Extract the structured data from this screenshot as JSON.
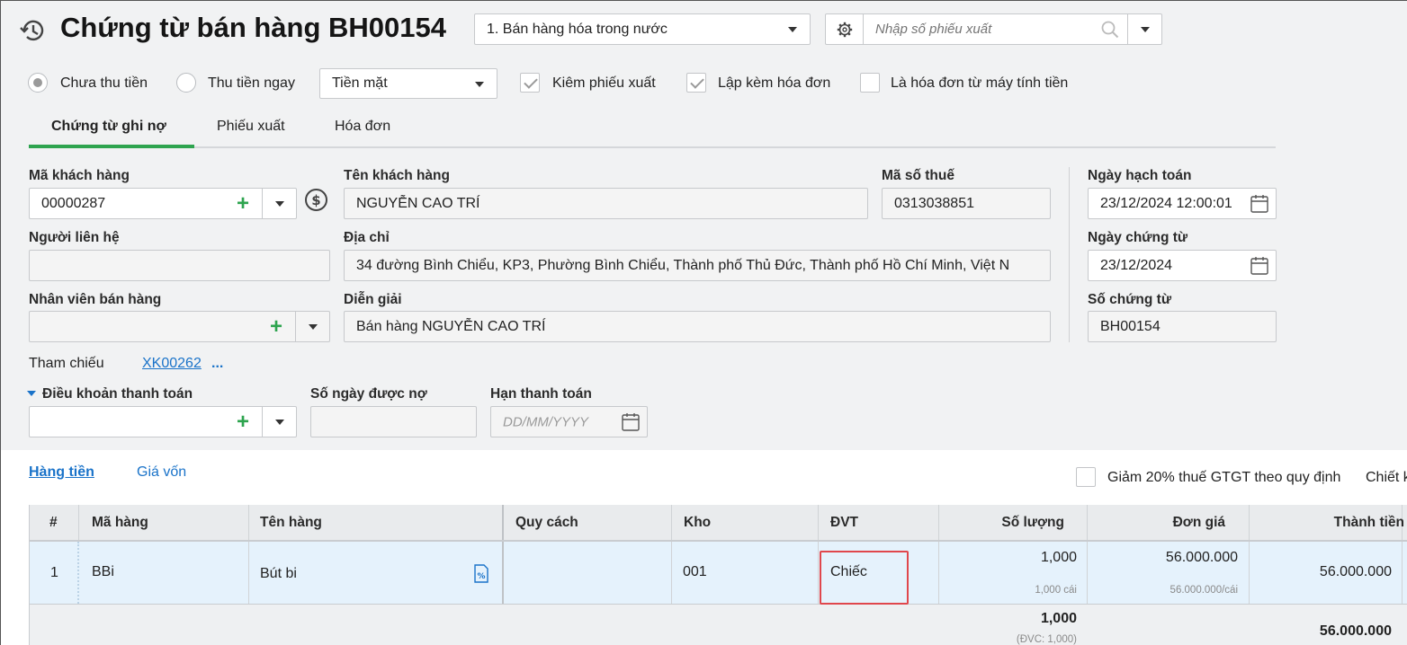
{
  "header": {
    "title": "Chứng từ bán hàng BH00154",
    "voucher_type": "1. Bán hàng hóa trong nước",
    "search_placeholder": "Nhập số phiếu xuất"
  },
  "options": {
    "unpaid_label": "Chưa thu tiền",
    "paid_now_label": "Thu tiền ngay",
    "payment_method": "Tiền mặt",
    "issue_slip_label": "Kiêm phiếu xuất",
    "with_invoice_label": "Lập kèm hóa đơn",
    "cash_register_invoice_label": "Là hóa đơn từ máy tính tiền"
  },
  "tabs": [
    {
      "label": "Chứng từ ghi nợ",
      "active": true
    },
    {
      "label": "Phiếu xuất",
      "active": false
    },
    {
      "label": "Hóa đơn",
      "active": false
    }
  ],
  "form": {
    "customer_code_label": "Mã khách hàng",
    "customer_code": "00000287",
    "customer_name_label": "Tên khách hàng",
    "customer_name": "NGUYỄN CAO TRÍ",
    "tax_code_label": "Mã số thuế",
    "tax_code": "0313038851",
    "contact_label": "Người liên hệ",
    "contact": "",
    "address_label": "Địa chỉ",
    "address": "34 đường Bình Chiểu, KP3, Phường Bình Chiểu, Thành phố Thủ Đức, Thành phố Hồ Chí Minh, Việt N",
    "salesperson_label": "Nhân viên bán hàng",
    "salesperson": "",
    "description_label": "Diễn giải",
    "description": "Bán hàng NGUYỄN CAO TRÍ",
    "posting_date_label": "Ngày hạch toán",
    "posting_date": "23/12/2024 12:00:01",
    "voucher_date_label": "Ngày chứng từ",
    "voucher_date": "23/12/2024",
    "voucher_no_label": "Số chứng từ",
    "voucher_no": "BH00154",
    "reference_label": "Tham chiếu",
    "reference_link": "XK00262",
    "reference_more": "...",
    "payment_terms_label": "Điều khoản thanh toán",
    "payment_terms": "",
    "credit_days_label": "Số ngày được nợ",
    "credit_days": "",
    "due_date_label": "Hạn thanh toán",
    "due_date_placeholder": "DD/MM/YYYY"
  },
  "detail_tabs": [
    {
      "label": "Hàng tiền",
      "active": true
    },
    {
      "label": "Giá vốn",
      "active": false
    }
  ],
  "vat_reduction_label": "Giảm 20% thuế GTGT theo quy định",
  "discount_label_partial": "Chiết k",
  "table": {
    "columns": [
      "#",
      "Mã hàng",
      "Tên hàng",
      "Quy cách",
      "Kho",
      "ĐVT",
      "Số lượng",
      "Đơn giá",
      "Thành tiền"
    ],
    "rows": [
      {
        "index": "1",
        "item_code": "BBi",
        "item_name": "Bút bi",
        "spec": "",
        "warehouse": "001",
        "unit": "Chiếc",
        "quantity": "1,000",
        "quantity_sub": "1,000 cái",
        "unit_price": "56.000.000",
        "unit_price_sub": "56.000.000/cái",
        "amount": "56.000.000"
      }
    ],
    "totals": {
      "quantity": "1,000",
      "quantity_sub": "(ĐVC: 1,000)",
      "amount": "56.000.000"
    }
  }
}
